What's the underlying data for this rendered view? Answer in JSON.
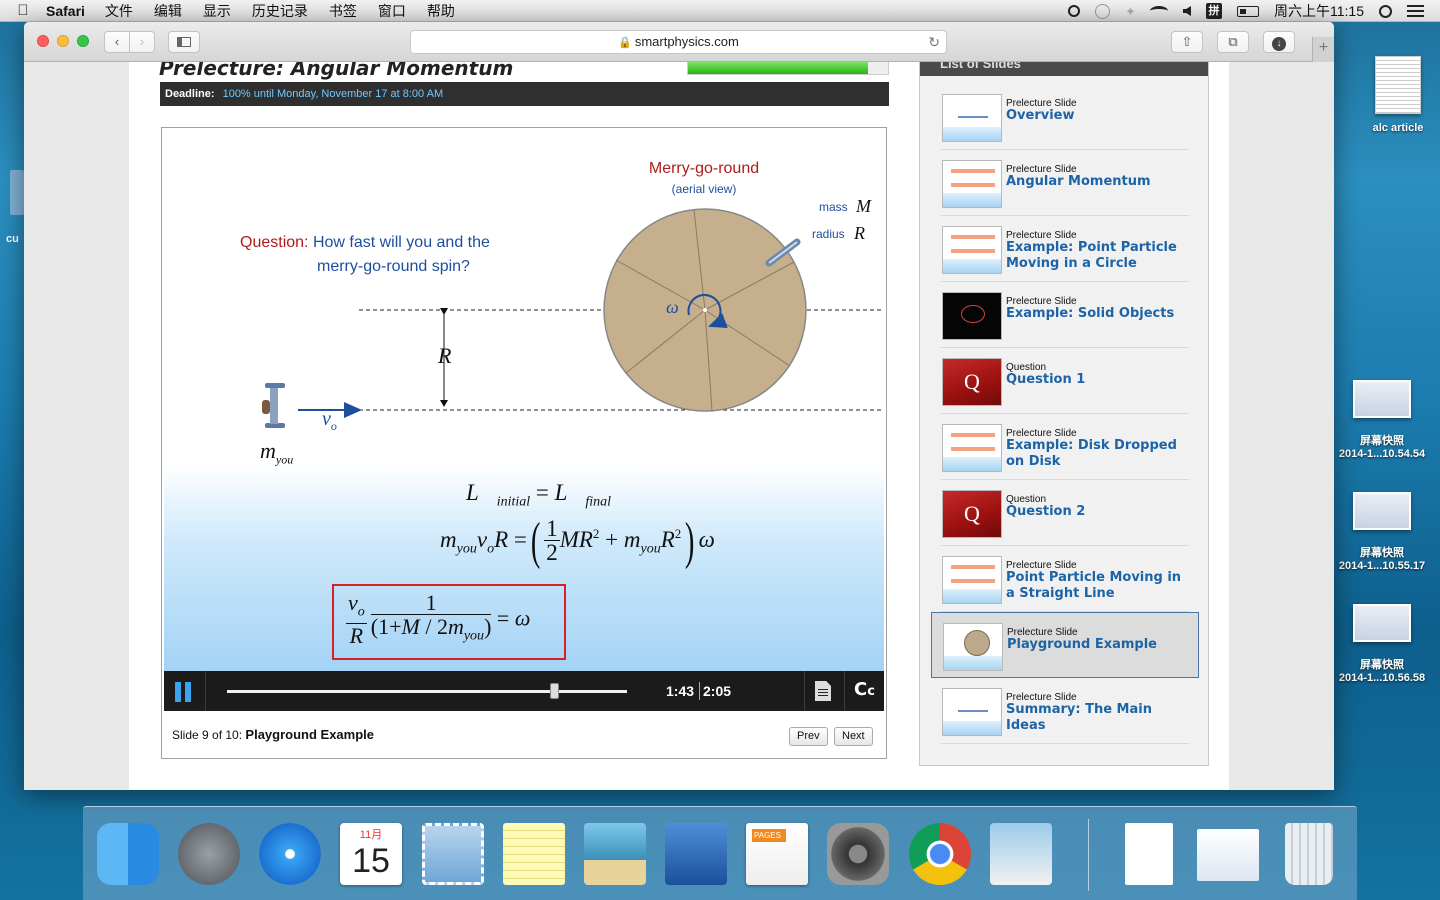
{
  "menubar": {
    "app": "Safari",
    "items": [
      "文件",
      "编辑",
      "显示",
      "历史记录",
      "书签",
      "窗口",
      "帮助"
    ],
    "clock": "周六上午11:15",
    "input_method": "拼"
  },
  "browser": {
    "url": "smartphysics.com"
  },
  "lesson": {
    "title": "Prelecture: Angular Momentum",
    "progress_fraction": 0.9,
    "deadline_label": "Deadline:",
    "deadline_value": "100% until Monday, November 17 at 8:00 AM"
  },
  "slide": {
    "question_label": "Question:",
    "question_line1": "How fast will you and the",
    "question_line2": "merry-go-round spin?",
    "mgr_title": "Merry-go-round",
    "mgr_subtitle": "(aerial view)",
    "mass_label": "mass",
    "mass_symbol": "M",
    "radius_label": "radius",
    "radius_symbol": "R",
    "R_symbol": "R",
    "v_symbol": "v",
    "v_sub": "o",
    "m_symbol": "m",
    "m_sub": "you",
    "omega_symbol": "ω"
  },
  "player": {
    "time_current": "1:43",
    "time_total": "2:05",
    "seek_fraction": 0.82,
    "cc_label": "C",
    "cc_label_small": "c"
  },
  "slide_footer": {
    "info": "Slide 9 of 10:",
    "current_title": "Playground Example",
    "prev": "Prev",
    "next": "Next"
  },
  "slides_list": {
    "header": "List of Slides",
    "items": [
      {
        "type": "Prelecture Slide",
        "title": "Overview",
        "thumb": "plain"
      },
      {
        "type": "Prelecture Slide",
        "title": "Angular Momentum",
        "thumb": "boxes"
      },
      {
        "type": "Prelecture Slide",
        "title": "Example: Point Particle Moving in a Circle",
        "thumb": "boxes"
      },
      {
        "type": "Prelecture Slide",
        "title": "Example: Solid Objects",
        "thumb": "dark"
      },
      {
        "type": "Question",
        "title": "Question 1",
        "thumb": "question"
      },
      {
        "type": "Prelecture Slide",
        "title": "Example: Disk Dropped on Disk",
        "thumb": "boxes"
      },
      {
        "type": "Question",
        "title": "Question 2",
        "thumb": "question"
      },
      {
        "type": "Prelecture Slide",
        "title": "Point Particle Moving in a Straight Line",
        "thumb": "boxes"
      },
      {
        "type": "Prelecture Slide",
        "title": "Playground Example",
        "thumb": "disk",
        "active": true
      },
      {
        "type": "Prelecture Slide",
        "title": "Summary: The Main Ideas",
        "thumb": "plain"
      }
    ]
  },
  "desktop": {
    "file1": "alc article",
    "left_stub": "cu",
    "shots": [
      {
        "line1": "屏幕快照",
        "line2": "2014-1...10.54.54"
      },
      {
        "line1": "屏幕快照",
        "line2": "2014-1...10.55.17"
      },
      {
        "line1": "屏幕快照",
        "line2": "2014-1...10.56.58"
      }
    ]
  },
  "dock": {
    "calendar_month": "11月",
    "calendar_day": "15",
    "pages_label": "PAGES",
    "question_glyph": "Q"
  }
}
